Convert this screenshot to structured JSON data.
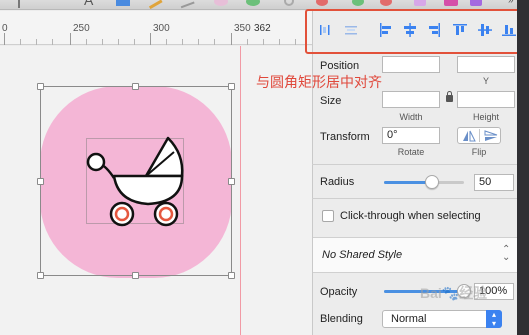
{
  "ruler": {
    "numbers": [
      "0",
      "250",
      "300",
      "350",
      "362"
    ]
  },
  "align_toolbar": {
    "buttons": [
      {
        "icon": "distribute-horizontal-icon"
      },
      {
        "icon": "distribute-vertical-icon"
      },
      {
        "icon": "align-left-icon"
      },
      {
        "icon": "align-horizontal-center-icon"
      },
      {
        "icon": "align-right-icon"
      },
      {
        "icon": "align-top-icon"
      },
      {
        "icon": "align-vertical-center-icon"
      },
      {
        "icon": "align-bottom-icon"
      }
    ],
    "highlight_color": "#e2513a"
  },
  "annotation": {
    "text": "与圆角矩形居中对齐",
    "color": "#e0483b"
  },
  "inspector": {
    "position": {
      "label": "Position",
      "x_value": "",
      "y_value": "",
      "y_label": "Y"
    },
    "size": {
      "label": "Size",
      "width_value": "",
      "height_value": "",
      "width_label": "Width",
      "height_label": "Height"
    },
    "transform": {
      "label": "Transform",
      "rotate_value": "0°",
      "rotate_label": "Rotate",
      "flip_label": "Flip"
    },
    "radius": {
      "label": "Radius",
      "value": "50",
      "slider_fraction": 0.6
    },
    "clickthrough": {
      "label": "Click-through when selecting",
      "checked": false
    },
    "shared_style": {
      "label": "No Shared Style",
      "chevron": "⌃"
    },
    "opacity": {
      "label": "Opacity",
      "value": "100%",
      "slider_fraction": 1.0
    },
    "blending": {
      "label": "Blending",
      "value": "Normal"
    }
  },
  "canvas": {
    "rounded_rect_color": "#f4b6d6",
    "guide_color": "#f19aa5"
  },
  "watermark": {
    "text": "Bai🐾经验"
  }
}
